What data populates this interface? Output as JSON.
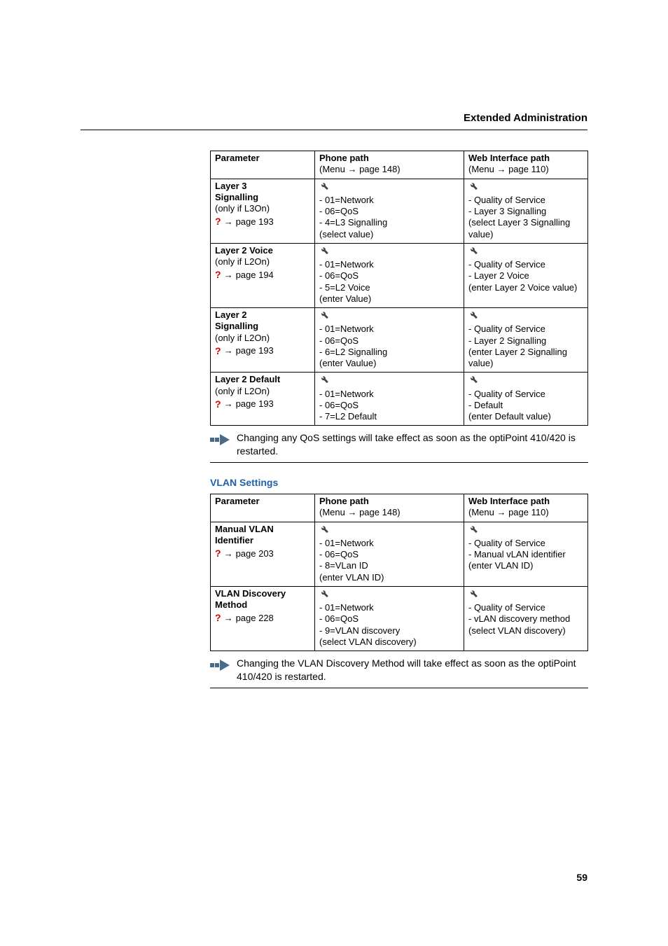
{
  "header": "Extended Administration",
  "pagenum": "59",
  "t1": {
    "head": {
      "c0": "Parameter",
      "c1a": "Phone path",
      "c1b": "(Menu → page 148)",
      "c2a": "Web Interface path",
      "c2b": "(Menu → page 110)"
    },
    "r0": {
      "name1": "Layer 3",
      "name2": "Signalling",
      "cond": "(only if L3On)",
      "ref": "page 193",
      "p0": "- 01=Network",
      "p1": "- 06=QoS",
      "p2": "- 4=L3 Signalling",
      "p3": "(select value)",
      "w0": "- Quality of Service",
      "w1": "- Layer 3 Signalling",
      "w2": "(select Layer 3 Signalling value)"
    },
    "r1": {
      "name1": "Layer 2 Voice",
      "cond": "(only if L2On)",
      "ref": "page 194",
      "p0": "- 01=Network",
      "p1": "- 06=QoS",
      "p2": "- 5=L2 Voice",
      "p3": "(enter Value)",
      "w0": "- Quality of Service",
      "w1": "- Layer 2 Voice",
      "w2": "(enter Layer 2 Voice value)"
    },
    "r2": {
      "name1": "Layer 2",
      "name2": "Signalling",
      "cond": "(only if L2On)",
      "ref": "page 193",
      "p0": "- 01=Network",
      "p1": "- 06=QoS",
      "p2": "- 6=L2 Signalling",
      "p3": "(enter Vaulue)",
      "w0": "- Quality of Service",
      "w1": "- Layer 2 Signalling",
      "w2": "(enter Layer 2 Signalling value)"
    },
    "r3": {
      "name1": "Layer 2 Default",
      "cond": "(only if L2On)",
      "ref": "page 193",
      "p0": "- 01=Network",
      "p1": "- 06=QoS",
      "p2": "- 7=L2 Default",
      "w0": "- Quality of Service",
      "w1": "- Default",
      "w2": "(enter Default value)"
    }
  },
  "note1": "Changing any QoS settings will take effect as soon as the optiPoint 410/420 is restarted.",
  "section2": "VLAN Settings",
  "t2": {
    "head": {
      "c0": "Parameter",
      "c1a": "Phone path",
      "c1b": "(Menu → page 148)",
      "c2a": "Web Interface path",
      "c2b": "(Menu → page 110)"
    },
    "r0": {
      "name1": "Manual VLAN",
      "name2": "Identifier",
      "ref": "page 203",
      "p0": "- 01=Network",
      "p1": "- 06=QoS",
      "p2": "- 8=VLan ID",
      "p3": "(enter VLAN ID)",
      "w0": "- Quality of Service",
      "w1": "- Manual vLAN identifier",
      "w2": "(enter VLAN ID)"
    },
    "r1": {
      "name1": "VLAN Discovery",
      "name2": "Method",
      "ref": "page 228",
      "p0": "- 01=Network",
      "p1": "- 06=QoS",
      "p2": "- 9=VLAN discovery",
      "p3": "(select VLAN discovery)",
      "w0": "- Quality of Service",
      "w1": "- vLAN discovery method",
      "w2": "(select VLAN discovery)"
    }
  },
  "note2": "Changing the VLAN Discovery Method will take effect as soon as the optiPoint 410/420 is restarted."
}
